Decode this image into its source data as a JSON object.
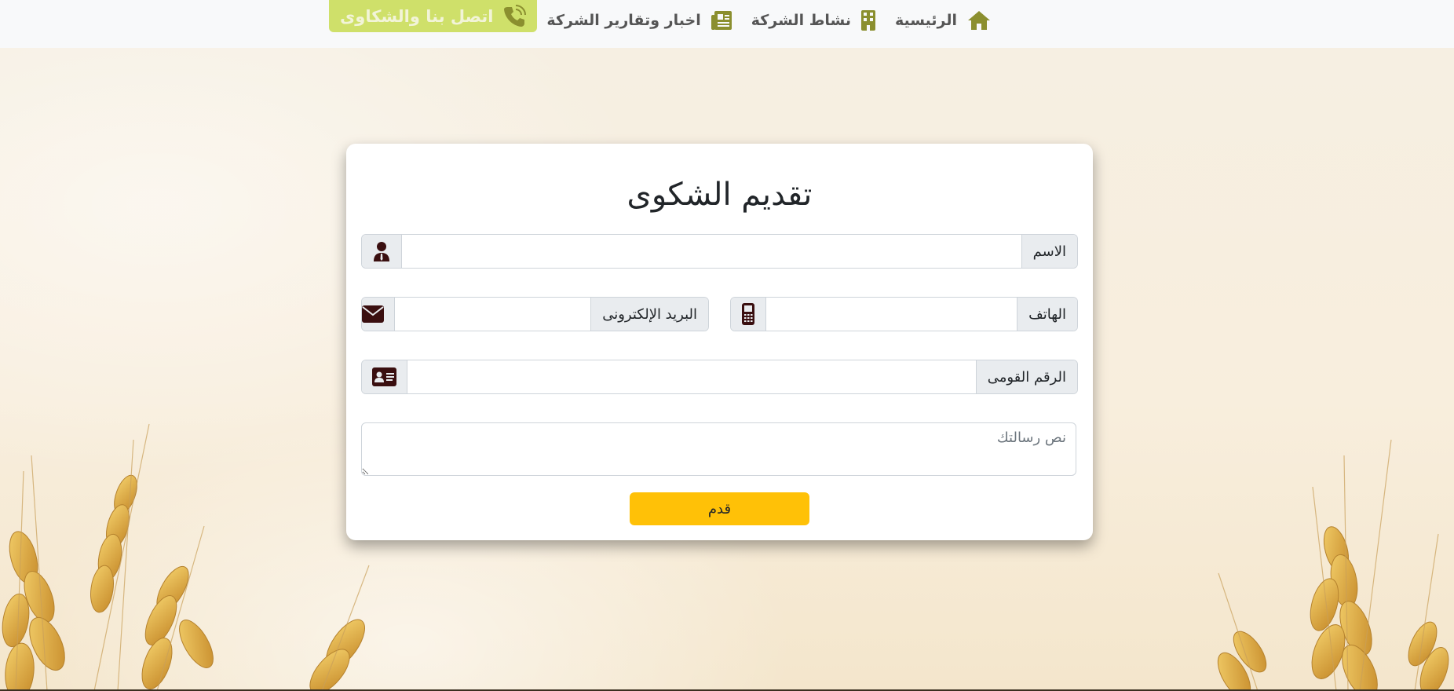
{
  "navbar": {
    "items": [
      {
        "label": "الرئيسية",
        "icon": "home-icon"
      },
      {
        "label": "نشاط الشركة",
        "icon": "building-icon"
      },
      {
        "label": "اخبار وتقارير الشركة",
        "icon": "newspaper-icon"
      },
      {
        "label": "اتصل بنا والشكاوى",
        "icon": "phone-call-icon"
      }
    ],
    "accent_color": "#8b8f2f",
    "contact_bg": "#cfe06a"
  },
  "form": {
    "title": "تقديم الشكوى",
    "name_label": "الاسم",
    "name_value": "",
    "phone_label": "الهاتف",
    "phone_value": "",
    "email_label": "البريد الإلكترونى",
    "email_value": "",
    "national_id_label": "الرقم القومى",
    "national_id_value": "",
    "message_placeholder": "نص رسالتك",
    "message_value": "",
    "submit_label": "قدم",
    "submit_color": "#ffc107",
    "icon_color": "#3a0f10"
  }
}
